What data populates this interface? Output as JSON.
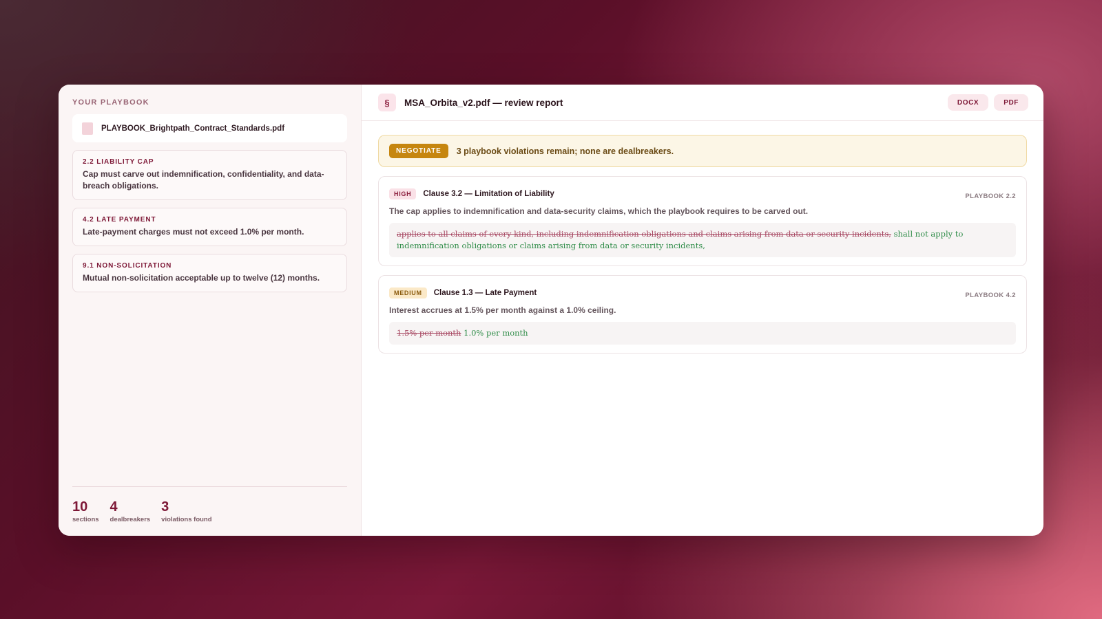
{
  "sidebar": {
    "title": "YOUR PLAYBOOK",
    "file_name": "PLAYBOOK_Brightpath_Contract_Standards.pdf",
    "rules": [
      {
        "title": "2.2 LIABILITY CAP",
        "text": "Cap must carve out indemnification, confidentiality, and data-breach obligations."
      },
      {
        "title": "4.2 LATE PAYMENT",
        "text": "Late-payment charges must not exceed 1.0% per month."
      },
      {
        "title": "9.1 NON-SOLICITATION",
        "text": "Mutual non-solicitation acceptable up to twelve (12) months."
      }
    ],
    "stats": [
      {
        "value": "10",
        "label": "sections"
      },
      {
        "value": "4",
        "label": "dealbreakers"
      },
      {
        "value": "3",
        "label": "violations found"
      }
    ]
  },
  "header": {
    "icon_glyph": "§",
    "title": "MSA_Orbita_v2.pdf — review report",
    "docx_label": "DOCX",
    "pdf_label": "PDF"
  },
  "verdict": {
    "badge": "NEGOTIATE",
    "text": "3 playbook violations remain; none are dealbreakers.",
    "color": "#c6860f"
  },
  "findings": [
    {
      "severity": "HIGH",
      "title": "Clause 3.2 — Limitation of Liability",
      "playbook": "PLAYBOOK 2.2",
      "description": "The cap applies to indemnification and data-security claims, which the playbook requires to be carved out.",
      "deleted": "applies to all claims of every kind, including indemnification obligations and claims arising from data or security incidents,",
      "inserted": "shall not apply to indemnification obligations or claims arising from data or security incidents,"
    },
    {
      "severity": "MEDIUM",
      "title": "Clause 1.3 — Late Payment",
      "playbook": "PLAYBOOK 4.2",
      "description": "Interest accrues at 1.5% per month against a 1.0% ceiling.",
      "deleted": "1.5% per month",
      "inserted": "1.0% per month"
    }
  ],
  "colors": {
    "accent": "#7d1736",
    "deletion": "#a64560",
    "insertion": "#2f8c48"
  }
}
